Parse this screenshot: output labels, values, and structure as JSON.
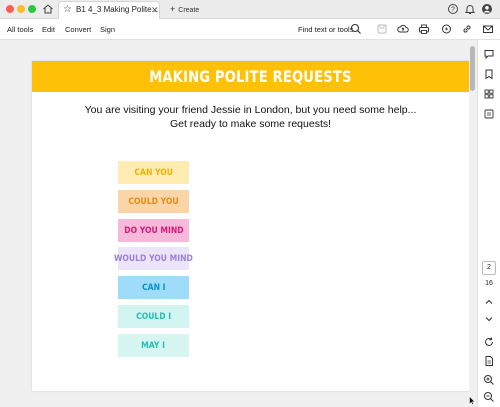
{
  "window": {
    "tab_title": "B1 4_3 Making Polite...",
    "create_label": "Create"
  },
  "toolbar": {
    "menu": [
      "All tools",
      "Edit",
      "Convert",
      "Sign"
    ],
    "find_label": "Find text or tools"
  },
  "document": {
    "title": "MAKING POLITE REQUESTS",
    "intro_line1": "You are visiting your friend Jessie in London, but you need some help...",
    "intro_line2": "Get ready to make some requests!",
    "phrases": [
      {
        "label": "CAN YOU",
        "bg": "#ffecb3",
        "fg": "#f3b000"
      },
      {
        "label": "COULD YOU",
        "bg": "#fbd5a8",
        "fg": "#e88a12"
      },
      {
        "label": "DO YOU MIND",
        "bg": "#f7b9da",
        "fg": "#d41b7b"
      },
      {
        "label": "WOULD YOU MIND",
        "bg": "#ece4f9",
        "fg": "#9c82d6"
      },
      {
        "label": "CAN I",
        "bg": "#9fdcf9",
        "fg": "#0a8fc9"
      },
      {
        "label": "COULD I",
        "bg": "#d2f5f2",
        "fg": "#21c0b3"
      },
      {
        "label": "MAY I",
        "bg": "#d7f6f1",
        "fg": "#21c0b3"
      }
    ]
  },
  "navigation": {
    "current_page": "2",
    "total_pages": "16"
  },
  "colors": {
    "banner": "#ffc107",
    "canvas": "#f0f0f0"
  }
}
